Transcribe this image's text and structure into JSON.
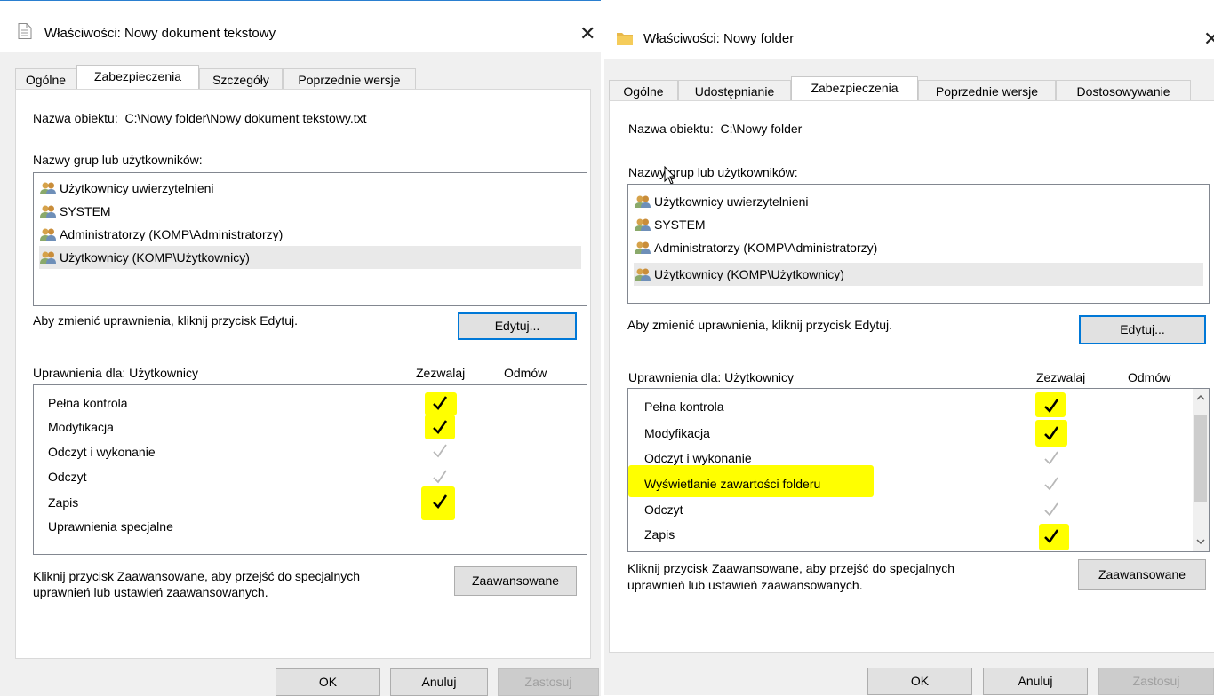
{
  "left_dialog": {
    "title": "Właściwości: Nowy dokument tekstowy",
    "tabs": [
      "Ogólne",
      "Zabezpieczenia",
      "Szczegóły",
      "Poprzednie wersje"
    ],
    "object_label": "Nazwa obiektu:",
    "object_value": "C:\\Nowy folder\\Nowy dokument tekstowy.txt",
    "groups_label": "Nazwy grup lub użytkowników:",
    "users": [
      "Użytkownicy uwierzytelnieni",
      "SYSTEM",
      "Administratorzy (KOMP\\Administratorzy)",
      "Użytkownicy (KOMP\\Użytkownicy)"
    ],
    "edit_hint": "Aby zmienić uprawnienia, kliknij przycisk Edytuj.",
    "edit_button": "Edytuj...",
    "permissions_for": "Uprawnienia dla: Użytkownicy",
    "allow_header": "Zezwalaj",
    "deny_header": "Odmów",
    "permissions": [
      {
        "name": "Pełna kontrola",
        "allow": "checked-highlighted"
      },
      {
        "name": "Modyfikacja",
        "allow": "checked-highlighted"
      },
      {
        "name": "Odczyt i wykonanie",
        "allow": "inherited"
      },
      {
        "name": "Odczyt",
        "allow": "inherited"
      },
      {
        "name": "Zapis",
        "allow": "checked-highlighted"
      },
      {
        "name": "Uprawnienia specjalne",
        "allow": "none"
      }
    ],
    "advanced_hint_1": "Kliknij przycisk Zaawansowane, aby przejść do specjalnych",
    "advanced_hint_2": "uprawnień lub ustawień zaawansowanych.",
    "advanced_button": "Zaawansowane",
    "ok": "OK",
    "cancel": "Anuluj",
    "apply": "Zastosuj"
  },
  "right_dialog": {
    "title": "Właściwości: Nowy folder",
    "tabs": [
      "Ogólne",
      "Udostępnianie",
      "Zabezpieczenia",
      "Poprzednie wersje",
      "Dostosowywanie"
    ],
    "object_label": "Nazwa obiektu:",
    "object_value": "C:\\Nowy folder",
    "groups_label": "Nazwy grup lub użytkowników:",
    "users": [
      "Użytkownicy uwierzytelnieni",
      "SYSTEM",
      "Administratorzy (KOMP\\Administratorzy)",
      "Użytkownicy (KOMP\\Użytkownicy)"
    ],
    "edit_hint": "Aby zmienić uprawnienia, kliknij przycisk Edytuj.",
    "edit_button": "Edytuj...",
    "permissions_for": "Uprawnienia dla: Użytkownicy",
    "allow_header": "Zezwalaj",
    "deny_header": "Odmów",
    "permissions": [
      {
        "name": "Pełna kontrola",
        "allow": "checked-highlighted"
      },
      {
        "name": "Modyfikacja",
        "allow": "checked-highlighted"
      },
      {
        "name": "Odczyt i wykonanie",
        "allow": "inherited"
      },
      {
        "name": "Wyświetlanie zawartości folderu",
        "allow": "inherited"
      },
      {
        "name": "Odczyt",
        "allow": "inherited"
      },
      {
        "name": "Zapis",
        "allow": "checked-highlighted"
      }
    ],
    "advanced_hint_1": "Kliknij przycisk Zaawansowane, aby przejść do specjalnych",
    "advanced_hint_2": "uprawnień lub ustawień zaawansowanych.",
    "advanced_button": "Zaawansowane",
    "ok": "OK",
    "cancel": "Anuluj",
    "apply": "Zastosuj"
  },
  "colors": {
    "highlight": "#ffff00",
    "focus_border": "#0078d7",
    "dialog_bg": "#f0f0f0"
  }
}
